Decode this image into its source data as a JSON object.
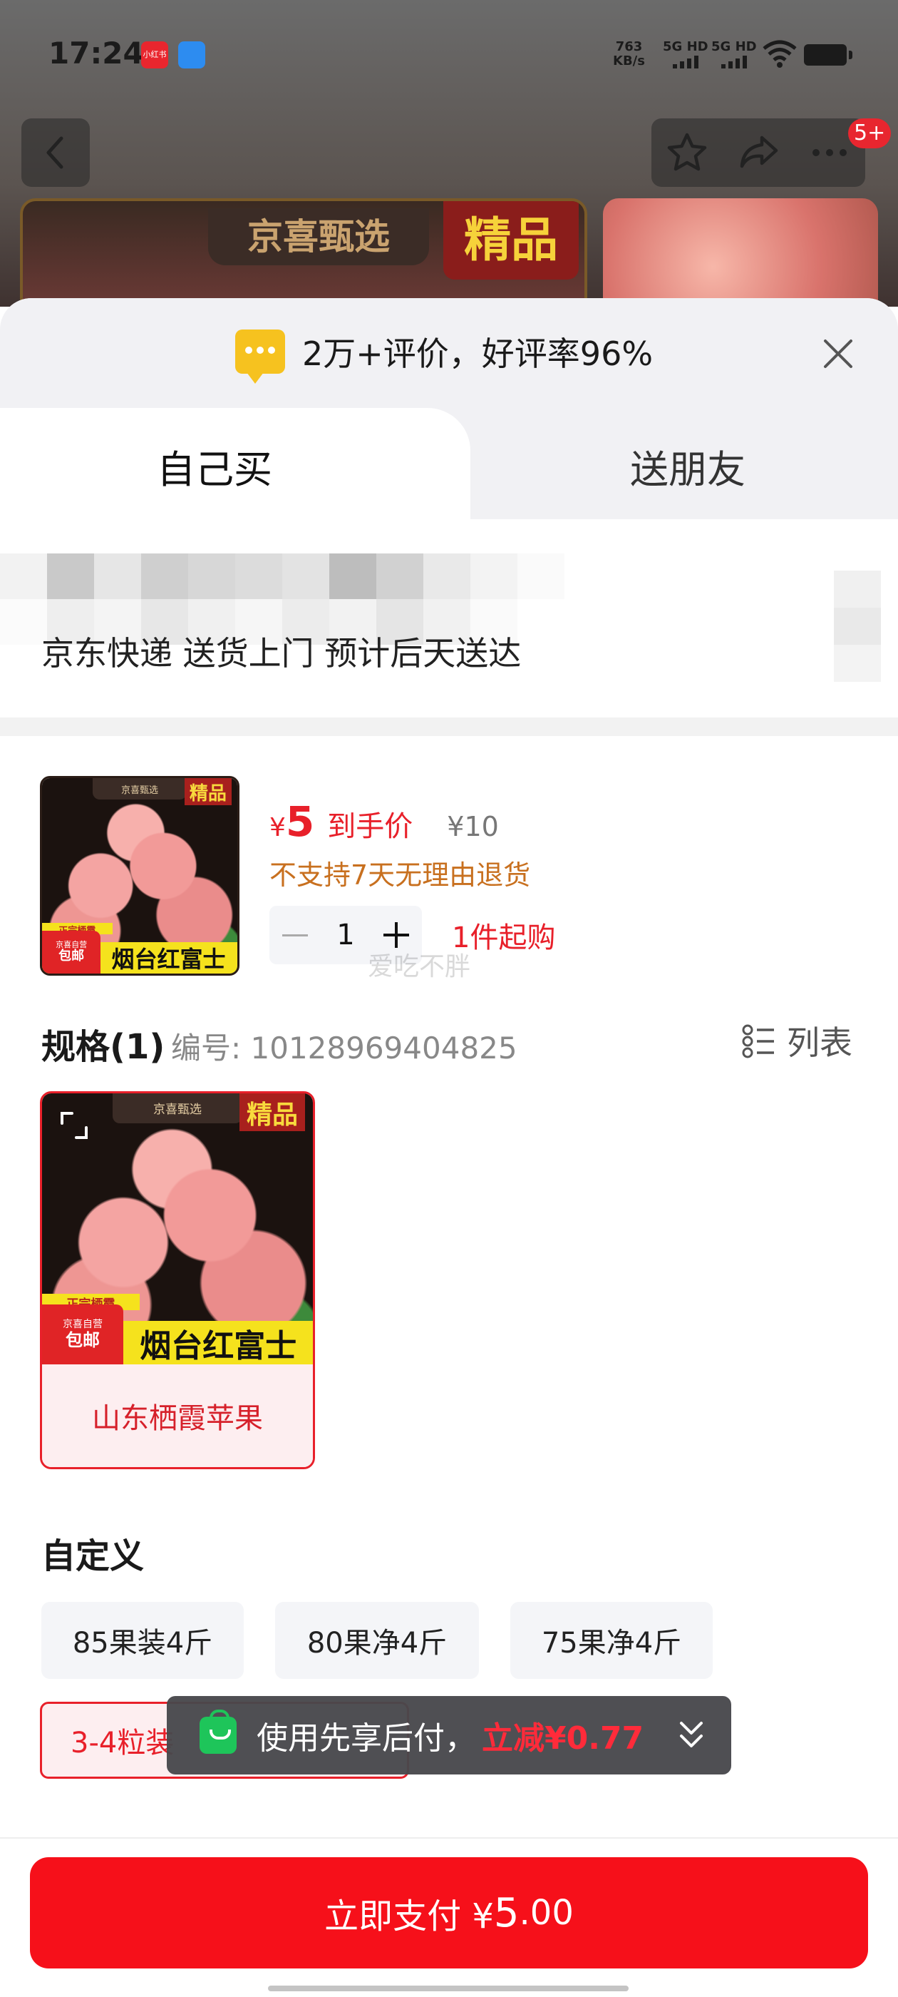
{
  "status_bar": {
    "time": "17:24",
    "app_icons": [
      "小红书",
      ""
    ],
    "net_rate": "763",
    "net_unit": "KB/s",
    "sim1": "5G HD",
    "sim2": "5G HD"
  },
  "top_nav": {
    "back_icon": "chevron-left-icon",
    "fav_icon": "star-icon",
    "share_icon": "share-icon",
    "more_icon": "more-icon",
    "badge": "5+"
  },
  "background_images": {
    "brand_text": "京喜甄选",
    "premium_text": "精品"
  },
  "sheet": {
    "review_summary": "2万+评价，好评率96%",
    "tabs": [
      {
        "label": "自己买",
        "selected": true
      },
      {
        "label": "送朋友",
        "selected": false
      }
    ],
    "address_text": "京东快递 送货上门 预计后天送达"
  },
  "product": {
    "image": {
      "brand": "京喜甄选",
      "premium": "精品",
      "banner": "烟台红富士",
      "subbanner": "正宗栖霞",
      "tag_small": "京喜自营",
      "tag_big": "包邮"
    },
    "currency": "¥",
    "price": "5",
    "price_label": "到手价",
    "original_price": "¥10",
    "return_policy": "不支持7天无理由退货",
    "quantity": "1",
    "min_purchase": "1件起购",
    "watermark": "爱吃不胖"
  },
  "spec": {
    "title": "规格(1)",
    "code": "编号: 10128969404825",
    "view_toggle": "列表",
    "items": [
      {
        "name": "山东栖霞苹果",
        "selected": true
      }
    ]
  },
  "custom": {
    "title": "自定义",
    "options": [
      {
        "label": "85果装4斤",
        "selected": false
      },
      {
        "label": "80果净4斤",
        "selected": false
      },
      {
        "label": "75果净4斤",
        "selected": false
      },
      {
        "label": "3-4粒装",
        "selected": true
      }
    ]
  },
  "toast": {
    "message": "使用先享后付，",
    "discount": "立减¥0.77"
  },
  "pay_button": {
    "label": "立即支付 ¥",
    "amount_int": "5",
    "amount_dec": ".00"
  },
  "colors": {
    "accent_red": "#f6101a",
    "price_red": "#e8202a",
    "warning_orange": "#c8701f",
    "toast_green": "#1ec55a"
  }
}
